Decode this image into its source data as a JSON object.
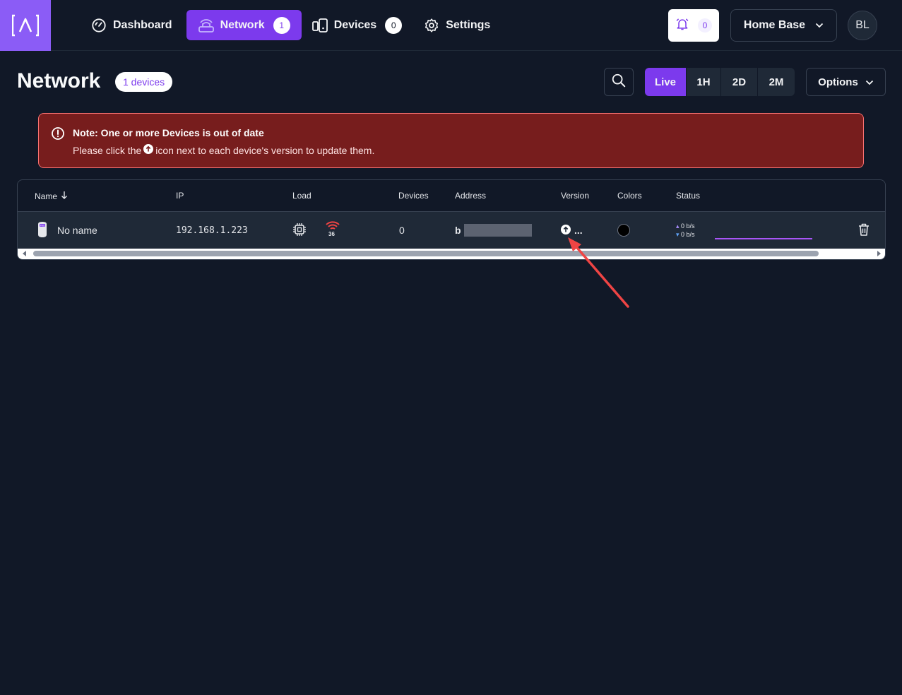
{
  "nav": {
    "items": [
      {
        "label": "Dashboard",
        "icon": "gauge-icon",
        "badge": null
      },
      {
        "label": "Network",
        "icon": "router-icon",
        "badge": "1",
        "active": true
      },
      {
        "label": "Devices",
        "icon": "devices-icon",
        "badge": "0"
      },
      {
        "label": "Settings",
        "icon": "gear-icon",
        "badge": null
      }
    ],
    "notifications_count": "0",
    "location": "Home Base",
    "avatar_initials": "BL",
    "accent": "#7c3aed"
  },
  "header": {
    "title": "Network",
    "count_label": "1 devices",
    "ranges": [
      "Live",
      "1H",
      "2D",
      "2M"
    ],
    "active_range": "Live",
    "options_label": "Options"
  },
  "alert": {
    "title": "Note: One or more Devices is out of date",
    "body_before": "Please click the",
    "body_after": "icon next to each device's version to update them.",
    "color": "#771d1d"
  },
  "table": {
    "columns": [
      "Name",
      "IP",
      "Load",
      "Devices",
      "Address",
      "Version",
      "Colors",
      "Status"
    ],
    "rows": [
      {
        "name": "No name",
        "ip": "192.168.1.223",
        "signal": "36",
        "devices": "0",
        "address_prefix": "b",
        "version": "...",
        "tx": "0 b/s",
        "rx": "0 b/s"
      }
    ]
  }
}
